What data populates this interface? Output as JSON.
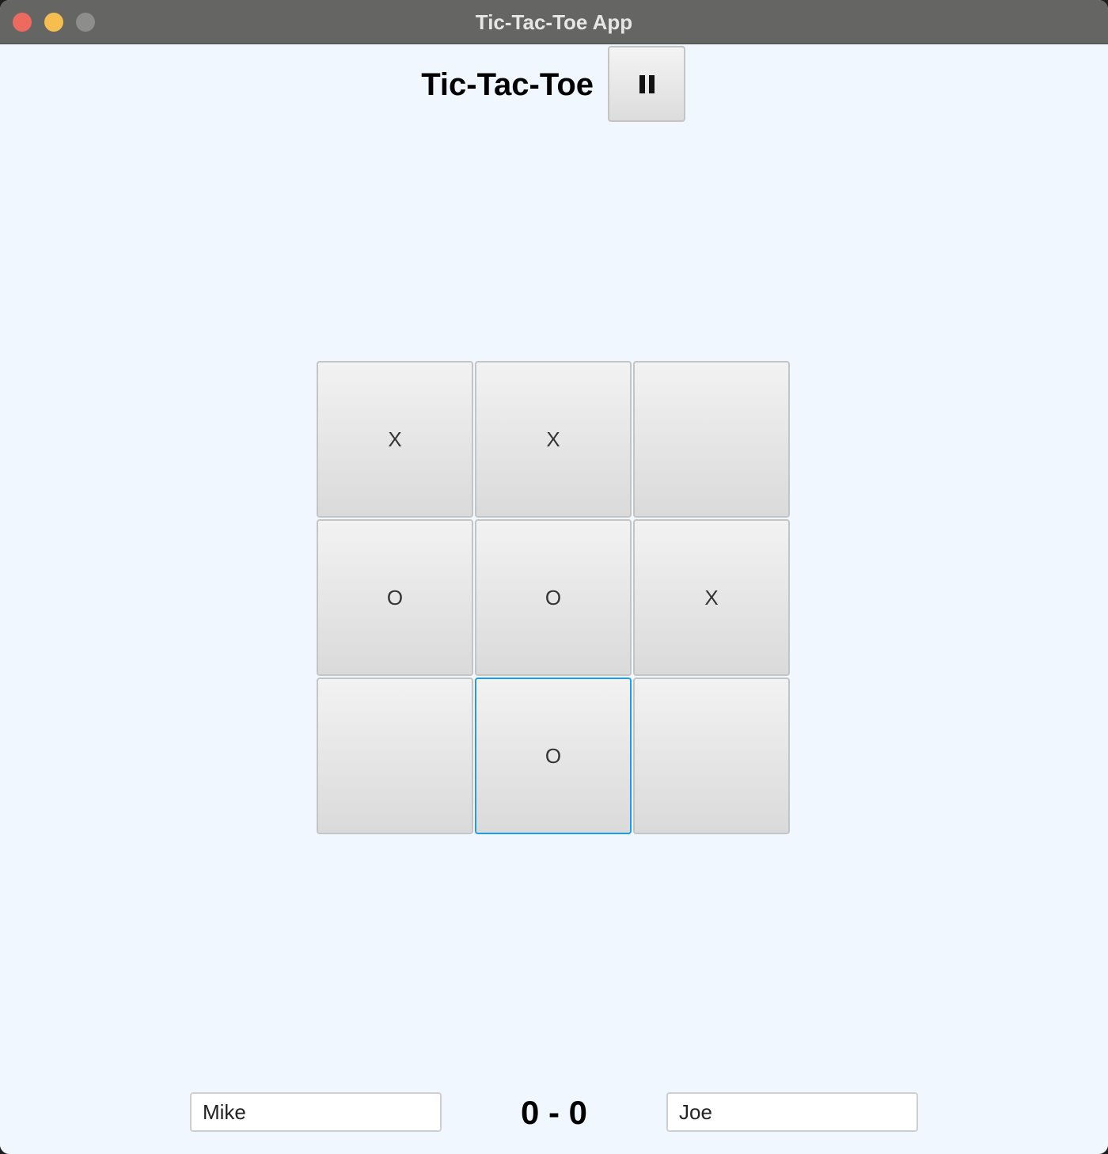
{
  "window": {
    "title": "Tic-Tac-Toe App"
  },
  "header": {
    "title": "Tic-Tac-Toe",
    "pause_button_icon": "pause-icon"
  },
  "board": {
    "cells": [
      "X",
      "X",
      "",
      "O",
      "O",
      "X",
      "",
      "O",
      ""
    ],
    "focused_cell_index": 7
  },
  "scoreboard": {
    "player1_name": "Mike",
    "score": "0 - 0",
    "player2_name": "Joe"
  },
  "colors": {
    "background": "#f0f7ff",
    "titlebar": "#656563",
    "focus_ring": "#1a9fe0",
    "close": "#ee6a5f",
    "minimize": "#f5be4f",
    "zoom_disabled": "#8d8d8b"
  }
}
